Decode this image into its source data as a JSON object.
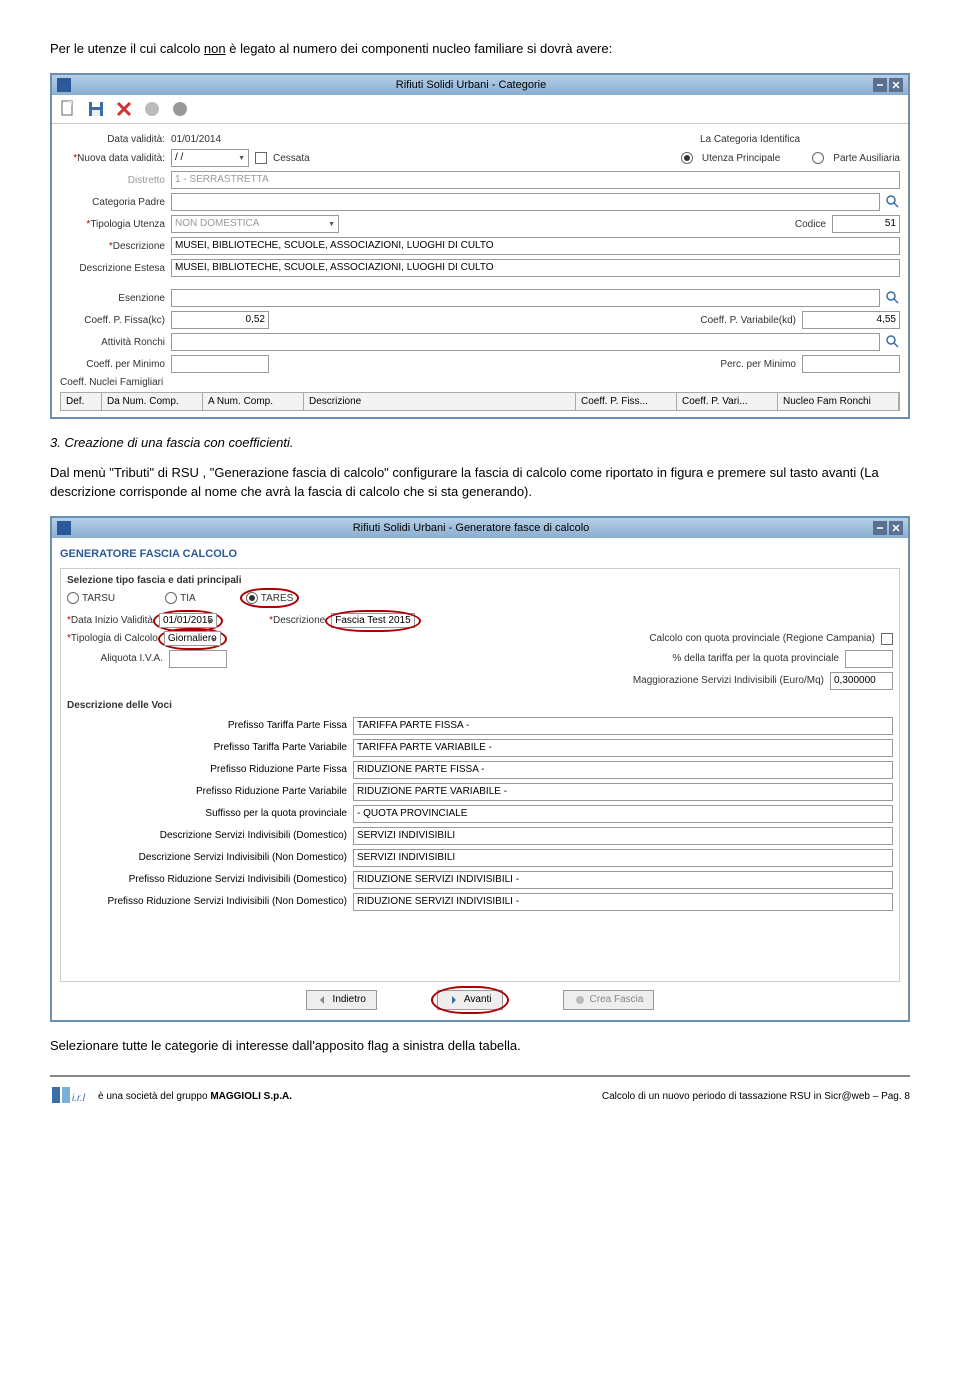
{
  "doc": {
    "intro": "Per le utenze il cui calcolo ",
    "non": "non",
    "intro2": " è legato al numero dei componenti nucleo familiare si dovrà avere:",
    "step3": "3. Creazione di una fascia con coefficienti.",
    "para2": "Dal menù \"Tributi\" di RSU , \"Generazione fascia di calcolo\" configurare la fascia di calcolo come riportato in figura e premere sul tasto avanti (La descrizione corrisponde al nome che avrà la fascia di calcolo che si sta generando).",
    "bottom": "Selezionare tutte le categorie di interesse dall'apposito flag a sinistra della tabella."
  },
  "win1": {
    "title": "Rifiuti Solidi Urbani - Categorie",
    "dataValidita_lbl": "Data validità:",
    "dataValidita_val": "01/01/2014",
    "nuovaDataValidita_lbl": "Nuova data validità:",
    "nuovaDataValidita_val": "/ /",
    "cessata_lbl": "Cessata",
    "catIdentifica_lbl": "La Categoria Identifica",
    "utenzaPrinc_lbl": "Utenza Principale",
    "parteAus_lbl": "Parte Ausiliaria",
    "distretto_lbl": "Distretto",
    "distretto_val": "1 - SERRASTRETTA",
    "catPadre_lbl": "Categoria Padre",
    "tipologia_lbl": "Tipologia Utenza",
    "tipologia_val": "NON DOMESTICA",
    "codice_lbl": "Codice",
    "codice_val": "51",
    "descrizione_lbl": "Descrizione",
    "descrizione_val": "MUSEI, BIBLIOTECHE, SCUOLE, ASSOCIAZIONI, LUOGHI DI CULTO",
    "descrEstesa_lbl": "Descrizione Estesa",
    "descrEstesa_val": "MUSEI, BIBLIOTECHE, SCUOLE, ASSOCIAZIONI, LUOGHI DI CULTO",
    "esenzione_lbl": "Esenzione",
    "coeffFissaKc_lbl": "Coeff. P. Fissa(kc)",
    "coeffFissaKc_val": "0,52",
    "coeffVarKd_lbl": "Coeff. P. Variabile(kd)",
    "coeffVarKd_val": "4,55",
    "attivitaRonchi_lbl": "Attività Ronchi",
    "coeffMin_lbl": "Coeff. per Minimo",
    "percMin_lbl": "Perc. per Minimo",
    "nucleiFam_lbl": "Coeff. Nuclei Famigliari",
    "cols": [
      "Def.",
      "Da Num. Comp.",
      "A Num. Comp.",
      "Descrizione",
      "Coeff. P. Fiss...",
      "Coeff. P. Vari...",
      "Nucleo Fam Ronchi"
    ]
  },
  "win2": {
    "title": "Rifiuti Solidi Urbani - Generatore fasce di calcolo",
    "header": "GENERATORE FASCIA CALCOLO",
    "seltipo": "Selezione tipo fascia e dati principali",
    "tarsu": "TARSU",
    "tia": "TIA",
    "tares": "TARES",
    "dataInizio_lbl": "Data Inizio Validità",
    "dataInizio_val": "01/01/2015",
    "descr_lbl": "Descrizione",
    "descr_val": "Fascia Test 2015",
    "tipCalcolo_lbl": "Tipologia di Calcolo",
    "tipCalcolo_val": "Giornaliero",
    "quotaProv_lbl": "Calcolo con quota provinciale (Regione Campania)",
    "aliquota_lbl": "Aliquota I.V.A.",
    "percTariffa_lbl": "% della tariffa per la quota provinciale",
    "maggiorazione_lbl": "Maggiorazione Servizi Indivisibili (Euro/Mq)",
    "maggiorazione_val": "0,300000",
    "descrVoci": "Descrizione delle Voci",
    "rows": [
      {
        "lbl": "Prefisso Tariffa Parte Fissa",
        "val": "TARIFFA PARTE FISSA -"
      },
      {
        "lbl": "Prefisso Tariffa Parte Variabile",
        "val": "TARIFFA PARTE VARIABILE -"
      },
      {
        "lbl": "Prefisso Riduzione Parte Fissa",
        "val": "RIDUZIONE PARTE FISSA -"
      },
      {
        "lbl": "Prefisso Riduzione Parte Variabile",
        "val": "RIDUZIONE PARTE VARIABILE -"
      },
      {
        "lbl": "Suffisso per la quota provinciale",
        "val": "- QUOTA PROVINCIALE"
      },
      {
        "lbl": "Descrizione Servizi Indivisibili (Domestico)",
        "val": "SERVIZI INDIVISIBILI"
      },
      {
        "lbl": "Descrizione Servizi Indivisibili (Non Domestico)",
        "val": "SERVIZI INDIVISIBILI"
      },
      {
        "lbl": "Prefisso Riduzione Servizi Indivisibili (Domestico)",
        "val": "RIDUZIONE SERVIZI INDIVISIBILI -"
      },
      {
        "lbl": "Prefisso Riduzione Servizi Indivisibili (Non Domestico)",
        "val": "RIDUZIONE SERVIZI INDIVISIBILI -"
      }
    ],
    "indietro": "Indietro",
    "avanti": "Avanti",
    "crea": "Crea Fascia"
  },
  "footer": {
    "left": "è una società del gruppo ",
    "maggioli": "MAGGIOLI S.p.A.",
    "right": "Calcolo di un nuovo periodo di tassazione RSU in Sicr@web – Pag. 8"
  }
}
